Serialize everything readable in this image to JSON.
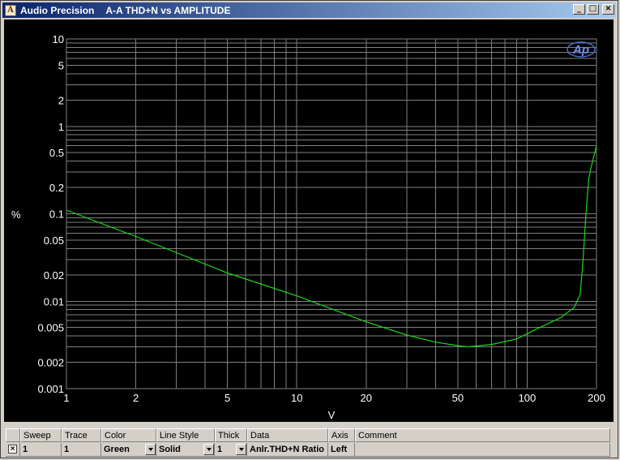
{
  "window": {
    "app_name": "Audio Precision",
    "title": "A-A THD+N vs AMPLITUDE",
    "min_label": "_",
    "max_label": "□",
    "close_label": "×"
  },
  "colors": {
    "plot_bg": "#000000",
    "grid": "#808080",
    "trace": "#19d819",
    "label": "#ffffff"
  },
  "logo": {
    "text": "Ap"
  },
  "chart_data": {
    "type": "line",
    "title": "",
    "xlabel": "V",
    "ylabel": "%",
    "xscale": "log",
    "yscale": "log",
    "xlim": [
      1,
      200
    ],
    "ylim": [
      0.001,
      10
    ],
    "grid": true,
    "x_ticks": [
      1,
      2,
      5,
      10,
      20,
      50,
      100,
      200
    ],
    "x_tick_labels": [
      "1",
      "2",
      "5",
      "10",
      "20",
      "50",
      "100",
      "200"
    ],
    "y_ticks": [
      0.001,
      0.002,
      0.005,
      0.01,
      0.02,
      0.05,
      0.1,
      0.2,
      0.5,
      1,
      2,
      5,
      10
    ],
    "y_tick_labels": [
      "0.001",
      "0.002",
      "0.005",
      "0.01",
      "0.02",
      "0.05",
      "0.1",
      "0.2",
      "0.5",
      "1",
      "2",
      "5",
      "10"
    ],
    "series": [
      {
        "x": [
          1,
          2,
          5,
          10,
          20,
          30,
          40,
          50,
          55,
          70,
          90,
          110,
          140,
          160,
          170,
          175,
          180,
          185,
          190,
          200
        ],
        "y": [
          0.11,
          0.055,
          0.021,
          0.0115,
          0.0058,
          0.0041,
          0.0034,
          0.0031,
          0.003,
          0.0032,
          0.0037,
          0.0048,
          0.0065,
          0.0085,
          0.012,
          0.03,
          0.1,
          0.25,
          0.35,
          0.6
        ]
      }
    ]
  },
  "table": {
    "headers": [
      "",
      "Sweep",
      "Trace",
      "Color",
      "Line Style",
      "Thick",
      "Data",
      "Axis",
      "Comment"
    ],
    "rows": [
      {
        "enabled": "×",
        "sweep": "1",
        "trace": "1",
        "color": "Green",
        "line_style": "Solid",
        "thick": "1",
        "data": "Anlr.THD+N Ratio",
        "axis": "Left",
        "comment": ""
      }
    ]
  }
}
